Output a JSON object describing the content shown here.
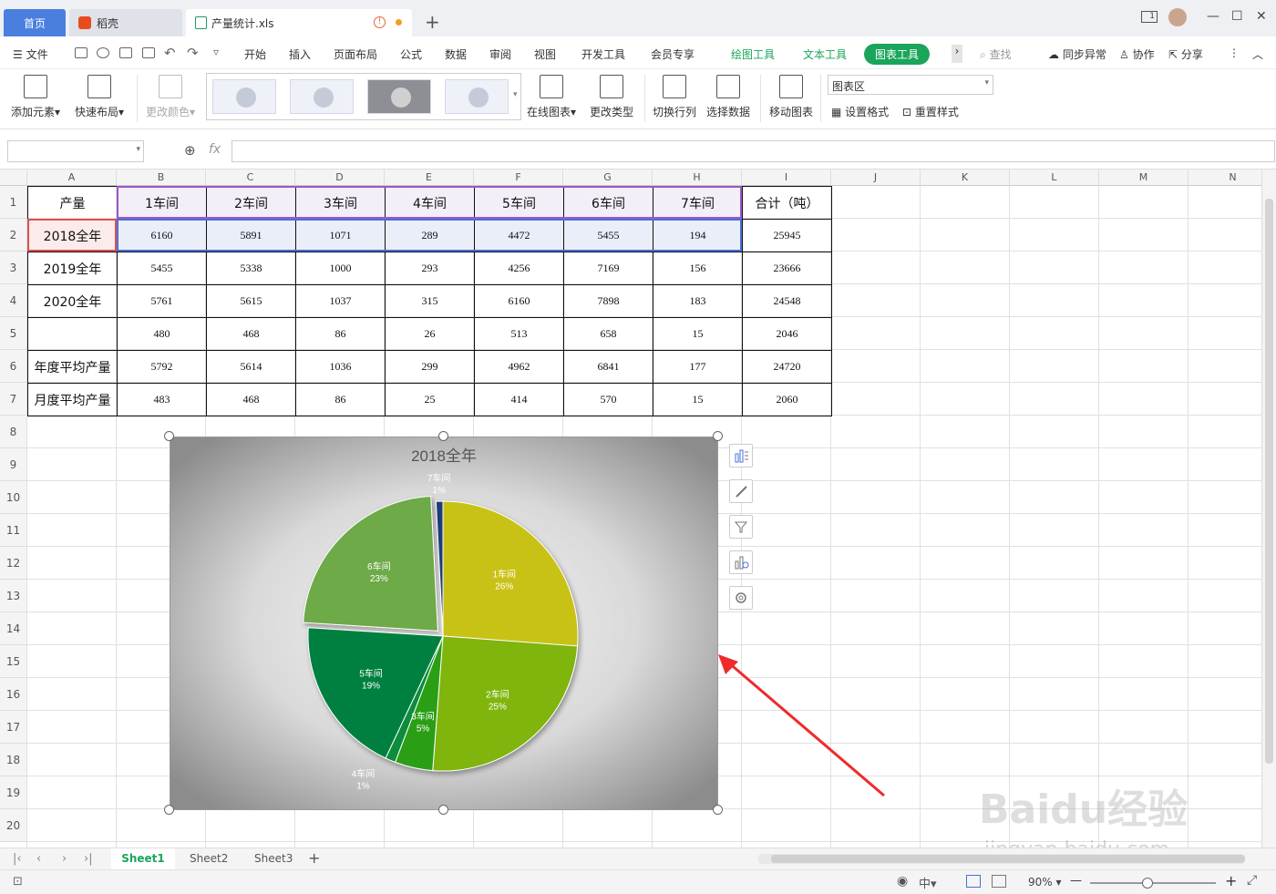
{
  "tabs": {
    "home": "首页",
    "daoke": "稻壳",
    "file": "产量统计.xls",
    "new": "+"
  },
  "window": {
    "minimize": "—",
    "maximize": "☐",
    "close": "✕",
    "page_icon": "1"
  },
  "menu": {
    "file": "文件",
    "items": [
      "开始",
      "插入",
      "页面布局",
      "公式",
      "数据",
      "审阅",
      "视图",
      "开发工具",
      "会员专享"
    ],
    "draw_tool": "绘图工具",
    "text_tool": "文本工具",
    "chart_tool": "图表工具",
    "search": "查找",
    "sync": "同步异常",
    "collab": "协作",
    "share": "分享"
  },
  "ribbon": {
    "add_element": "添加元素",
    "quick_layout": "快速布局",
    "change_color": "更改颜色",
    "online_chart": "在线图表",
    "change_type": "更改类型",
    "switch_rowcol": "切换行列",
    "select_data": "选择数据",
    "move_chart": "移动图表",
    "chart_area": "图表区",
    "set_format": "设置格式",
    "reset_style": "重置样式"
  },
  "formula": {
    "fx": "fx",
    "zoom_icon": "⊕"
  },
  "columns": [
    "A",
    "B",
    "C",
    "D",
    "E",
    "F",
    "G",
    "H",
    "I",
    "J",
    "K",
    "L",
    "M",
    "N"
  ],
  "rows": [
    "1",
    "2",
    "3",
    "4",
    "5",
    "6",
    "7",
    "8",
    "9",
    "10",
    "11",
    "12",
    "13",
    "14",
    "15",
    "16",
    "17",
    "18",
    "19",
    "20"
  ],
  "table": [
    [
      "产量",
      "1车间",
      "2车间",
      "3车间",
      "4车间",
      "5车间",
      "6车间",
      "7车间",
      "合计（吨）"
    ],
    [
      "2018全年",
      "6160",
      "5891",
      "1071",
      "289",
      "4472",
      "5455",
      "194",
      "25945"
    ],
    [
      "2019全年",
      "5455",
      "5338",
      "1000",
      "293",
      "4256",
      "7169",
      "156",
      "23666"
    ],
    [
      "2020全年",
      "5761",
      "5615",
      "1037",
      "315",
      "6160",
      "7898",
      "183",
      "24548"
    ],
    [
      "",
      "480",
      "468",
      "86",
      "26",
      "513",
      "658",
      "15",
      "2046"
    ],
    [
      "年度平均产量",
      "5792",
      "5614",
      "1036",
      "299",
      "4962",
      "6841",
      "177",
      "24720"
    ],
    [
      "月度平均产量",
      "483",
      "468",
      "86",
      "25",
      "414",
      "570",
      "15",
      "2060"
    ]
  ],
  "chart_data": {
    "type": "pie",
    "title": "2018全年",
    "categories": [
      "1车间",
      "2车间",
      "3车间",
      "4车间",
      "5车间",
      "6车间",
      "7车间"
    ],
    "values": [
      6160,
      5891,
      1071,
      289,
      4472,
      5455,
      194
    ],
    "percent_labels": [
      "26%",
      "25%",
      "5%",
      "1%",
      "19%",
      "23%",
      "1%"
    ],
    "colors": [
      "#c9c219",
      "#7fb511",
      "#2a9f18",
      "#0d8c3a",
      "#00803f",
      "#6eaa46",
      "#1f3e7a"
    ]
  },
  "sheets": {
    "active": "Sheet1",
    "others": [
      "Sheet2",
      "Sheet3"
    ],
    "add": "+"
  },
  "status": {
    "zoom": "90%",
    "minus": "—",
    "plus": "+"
  },
  "watermark": {
    "line1": "Baidu经验",
    "line2": "jingyan.baidu.com"
  }
}
